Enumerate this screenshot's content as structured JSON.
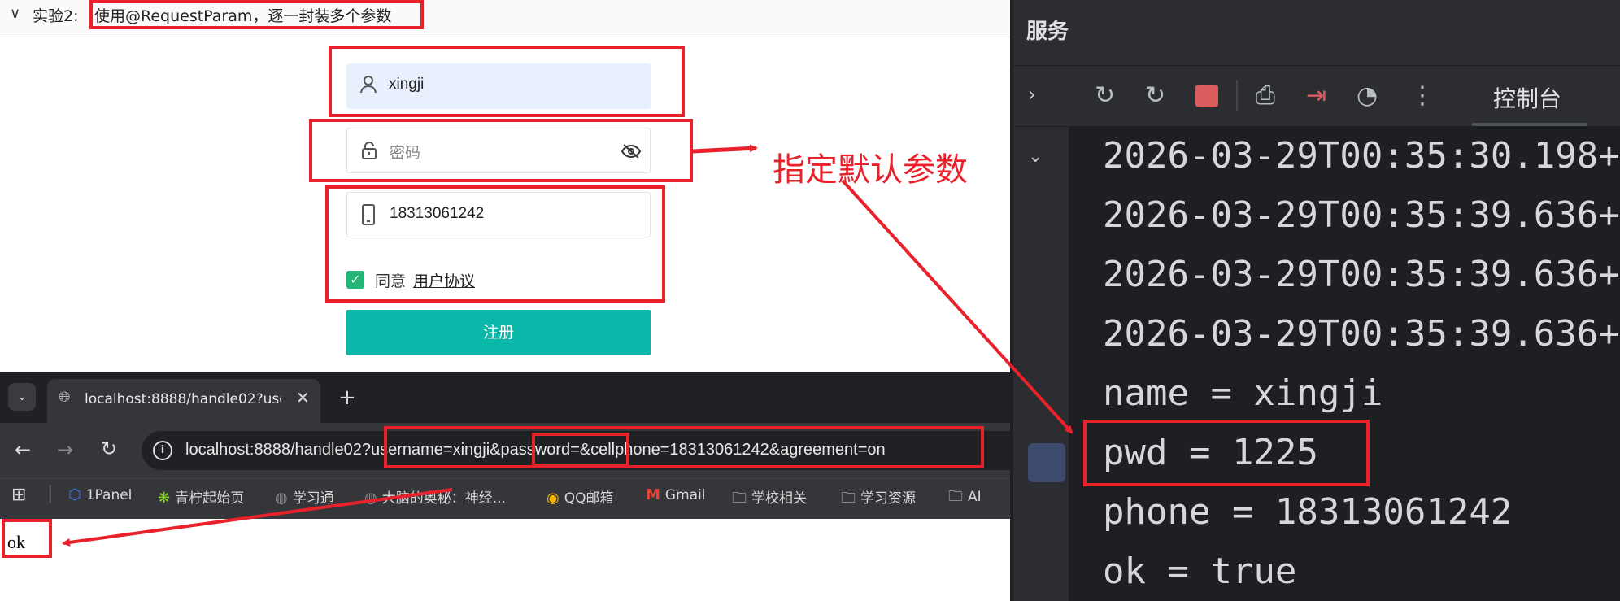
{
  "experiment": {
    "chevron": "∨",
    "label": "实验2:",
    "title": "使用@RequestParam，逐一封装多个参数"
  },
  "form": {
    "username_value": "xingji",
    "password_placeholder": "密码",
    "phone_value": "18313061242",
    "agree_text": "同意",
    "agree_link": "用户协议",
    "register_label": "注册",
    "icons": {
      "user": "user-icon",
      "lock": "lock-icon",
      "eye": "eye-hidden-icon",
      "phone": "phone-icon",
      "check": "checkbox-checked-icon"
    }
  },
  "browser": {
    "tab_title": "localhost:8888/handle02?use",
    "url": "localhost:8888/handle02?username=xingji&password=&cellphone=18313061242&agreement=on",
    "bookmarks": [
      "1Panel",
      "青柠起始页",
      "学习通",
      "大脑的奥秘：神经...",
      "QQ邮箱",
      "Gmail",
      "学校相关",
      "学习资源",
      "AI"
    ],
    "page_body": "ok"
  },
  "ide": {
    "panel_title": "服务",
    "console_tab": "控制台",
    "log_lines": [
      "2026-03-29T00:35:30.198+",
      "2026-03-29T00:35:39.636+",
      "2026-03-29T00:35:39.636+",
      "2026-03-29T00:35:39.636+",
      "name = xingji",
      "pwd = 1225",
      "phone = 18313061242",
      "ok = true"
    ]
  },
  "annotation": {
    "label": "指定默认参数",
    "color": "#e8212a"
  },
  "colors": {
    "accent_teal": "#0bb7a9",
    "check_green": "#22b573",
    "ide_bg": "#1e1f22",
    "autofill": "#e8f0fe"
  }
}
